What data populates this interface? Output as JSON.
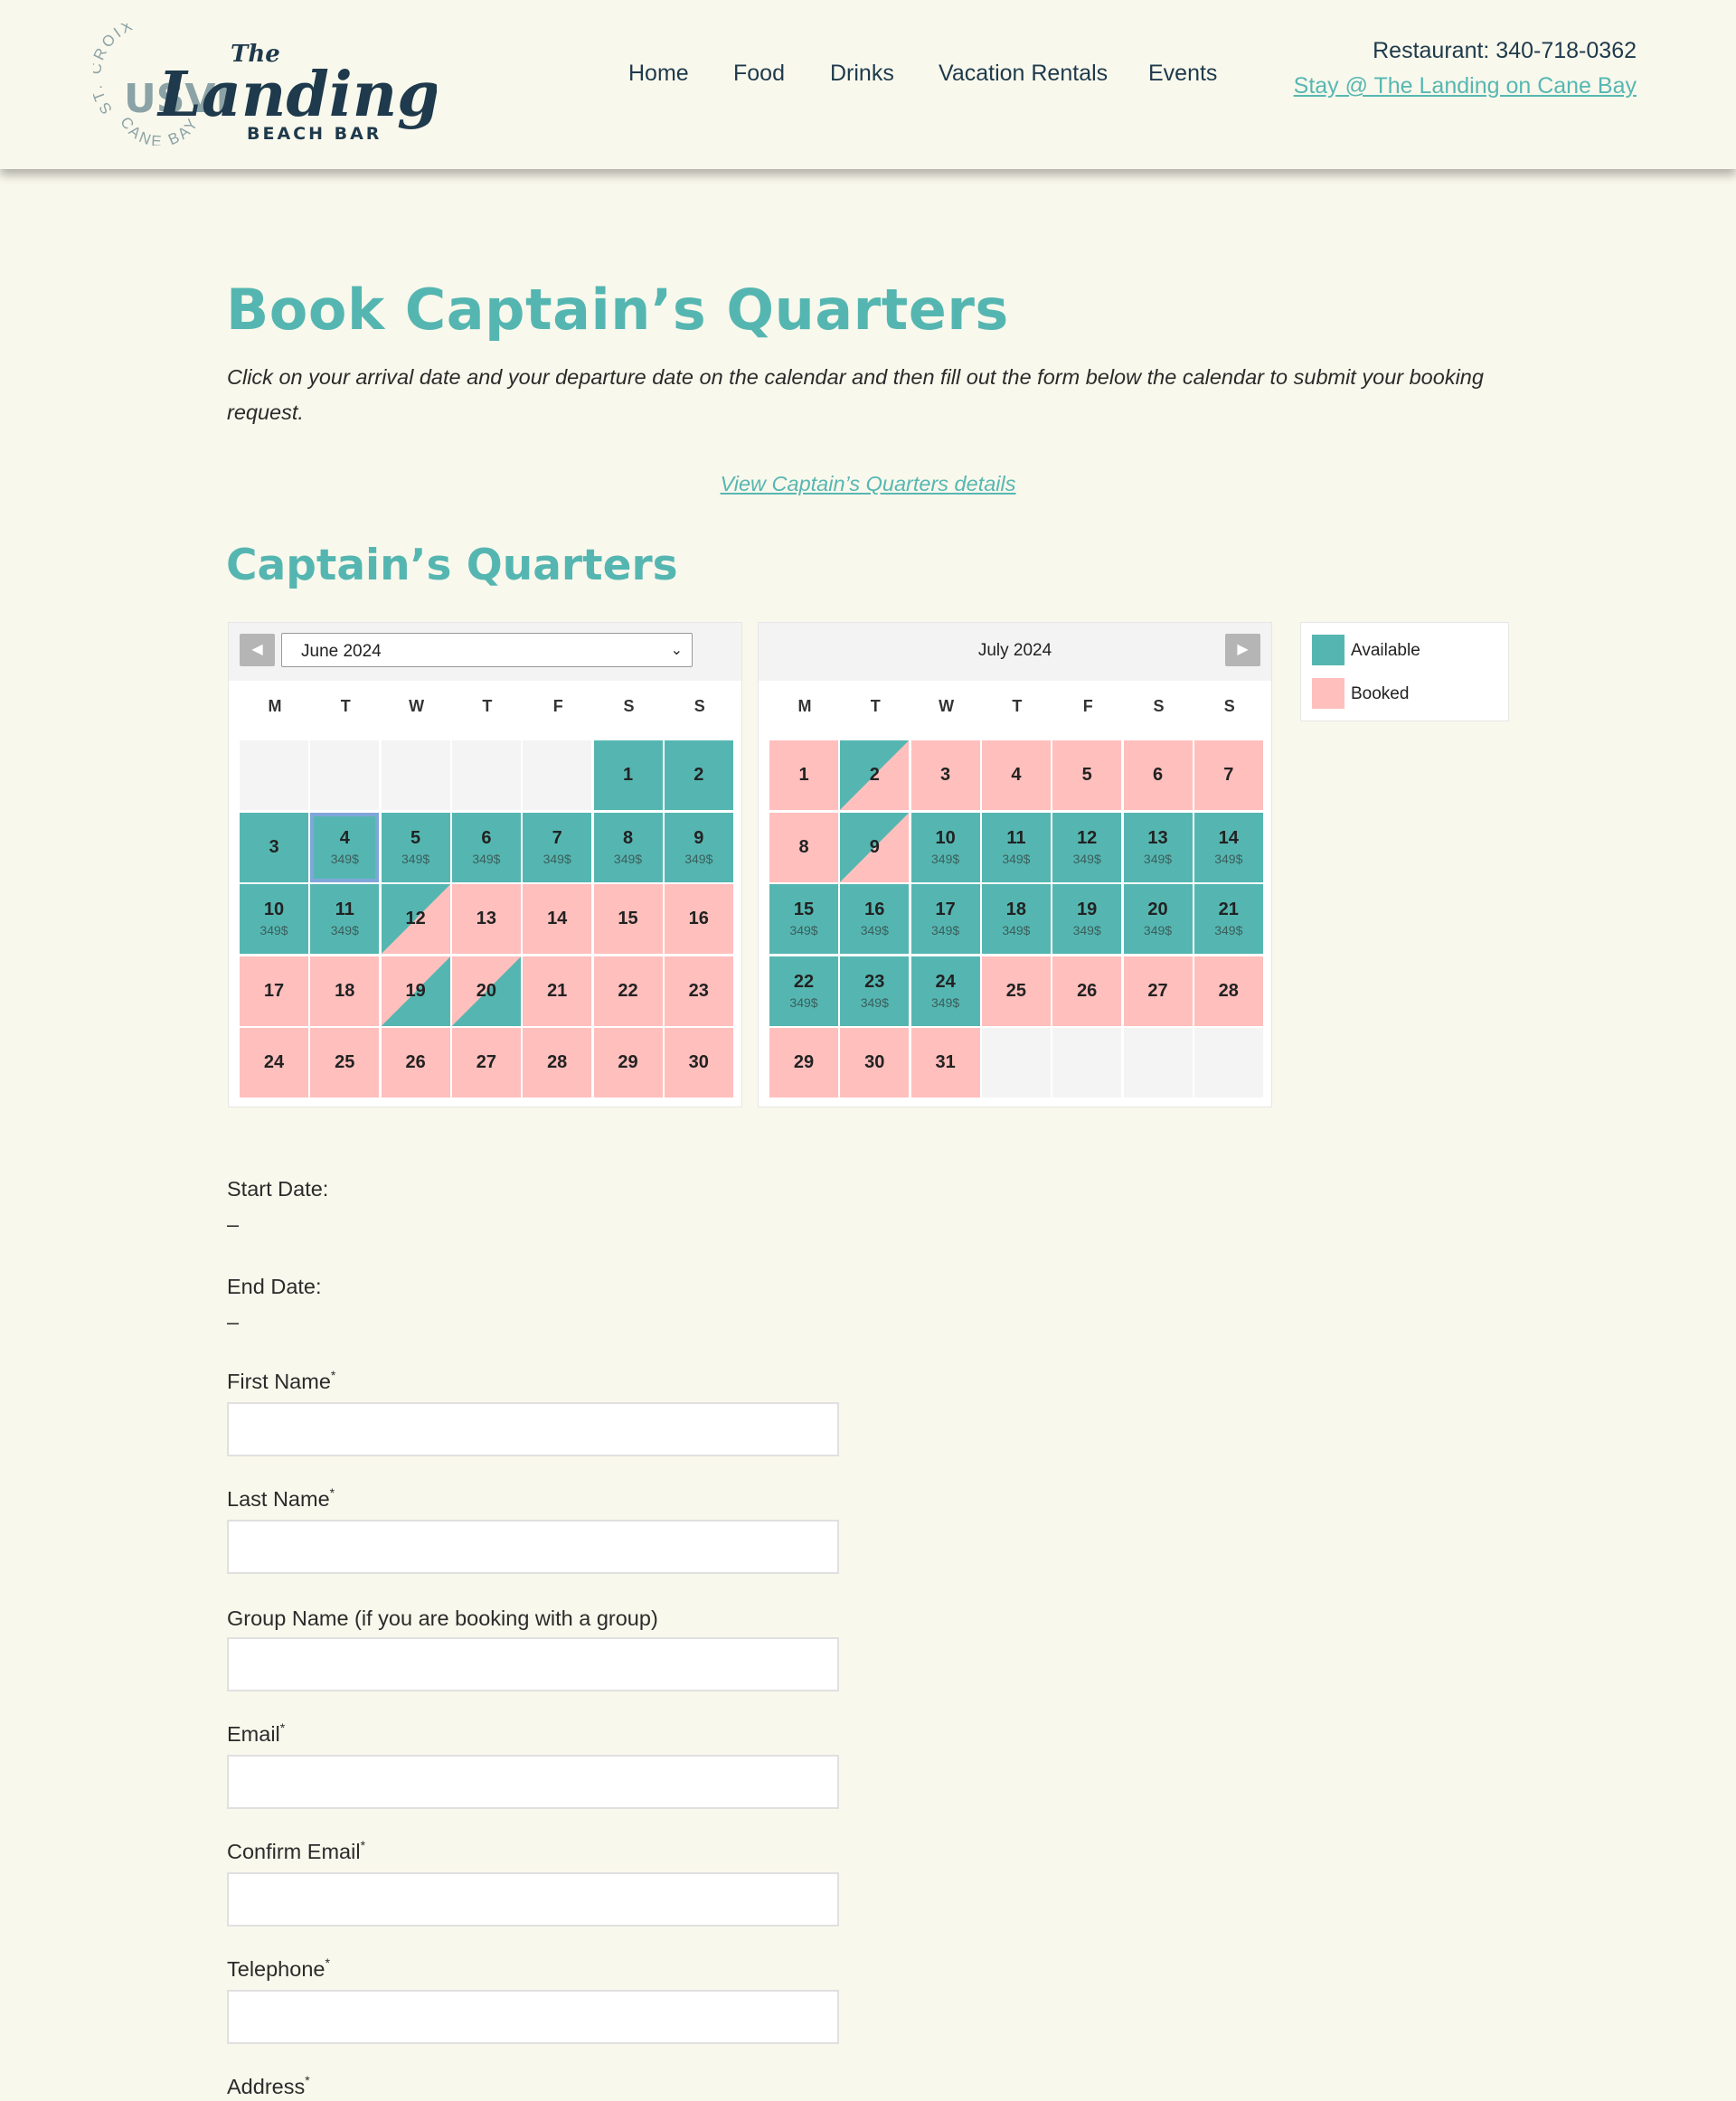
{
  "header": {
    "logo": {
      "arc_top": "ST. CROIX",
      "arc_bottom": "CANE BAY",
      "badge": "USVI",
      "the": "The",
      "name": "Landing",
      "sub": "BEACH BAR"
    },
    "nav": [
      "Home",
      "Food",
      "Drinks",
      "Vacation Rentals",
      "Events"
    ],
    "phone": "Restaurant: 340-718-0362",
    "stay_link": "Stay @ The Landing on Cane Bay"
  },
  "page": {
    "title": "Book Captain’s Quarters",
    "intro": "Click on your arrival date and your departure date on the calendar and then fill out the form below the calendar to submit your booking request.",
    "details_link": "View Captain’s Quarters details",
    "subtitle": "Captain’s Quarters"
  },
  "calendar": {
    "weekdays": [
      "M",
      "T",
      "W",
      "T",
      "F",
      "S",
      "S"
    ],
    "months": [
      {
        "label": "June 2024",
        "is_select": true,
        "days": [
          {
            "t": "em"
          },
          {
            "t": "em"
          },
          {
            "t": "em"
          },
          {
            "t": "em"
          },
          {
            "t": "em"
          },
          {
            "n": "1",
            "t": "av"
          },
          {
            "n": "2",
            "t": "av"
          },
          {
            "n": "3",
            "t": "av"
          },
          {
            "n": "4",
            "t": "av",
            "p": "349$",
            "sel": true
          },
          {
            "n": "5",
            "t": "av",
            "p": "349$"
          },
          {
            "n": "6",
            "t": "av",
            "p": "349$"
          },
          {
            "n": "7",
            "t": "av",
            "p": "349$"
          },
          {
            "n": "8",
            "t": "av",
            "p": "349$"
          },
          {
            "n": "9",
            "t": "av",
            "p": "349$"
          },
          {
            "n": "10",
            "t": "av",
            "p": "349$"
          },
          {
            "n": "11",
            "t": "av",
            "p": "349$"
          },
          {
            "n": "12",
            "t": "pm"
          },
          {
            "n": "13",
            "t": "bk"
          },
          {
            "n": "14",
            "t": "bk"
          },
          {
            "n": "15",
            "t": "bk"
          },
          {
            "n": "16",
            "t": "bk"
          },
          {
            "n": "17",
            "t": "bk"
          },
          {
            "n": "18",
            "t": "bk"
          },
          {
            "n": "19",
            "t": "am"
          },
          {
            "n": "20",
            "t": "am"
          },
          {
            "n": "21",
            "t": "bk"
          },
          {
            "n": "22",
            "t": "bk"
          },
          {
            "n": "23",
            "t": "bk"
          },
          {
            "n": "24",
            "t": "bk"
          },
          {
            "n": "25",
            "t": "bk"
          },
          {
            "n": "26",
            "t": "bk"
          },
          {
            "n": "27",
            "t": "bk"
          },
          {
            "n": "28",
            "t": "bk"
          },
          {
            "n": "29",
            "t": "bk"
          },
          {
            "n": "30",
            "t": "bk"
          }
        ]
      },
      {
        "label": "July 2024",
        "is_select": false,
        "days": [
          {
            "n": "1",
            "t": "bk"
          },
          {
            "n": "2",
            "t": "pm"
          },
          {
            "n": "3",
            "t": "bk"
          },
          {
            "n": "4",
            "t": "bk"
          },
          {
            "n": "5",
            "t": "bk"
          },
          {
            "n": "6",
            "t": "bk"
          },
          {
            "n": "7",
            "t": "bk"
          },
          {
            "n": "8",
            "t": "bk"
          },
          {
            "n": "9",
            "t": "pm"
          },
          {
            "n": "10",
            "t": "av",
            "p": "349$"
          },
          {
            "n": "11",
            "t": "av",
            "p": "349$"
          },
          {
            "n": "12",
            "t": "av",
            "p": "349$"
          },
          {
            "n": "13",
            "t": "av",
            "p": "349$"
          },
          {
            "n": "14",
            "t": "av",
            "p": "349$"
          },
          {
            "n": "15",
            "t": "av",
            "p": "349$"
          },
          {
            "n": "16",
            "t": "av",
            "p": "349$"
          },
          {
            "n": "17",
            "t": "av",
            "p": "349$"
          },
          {
            "n": "18",
            "t": "av",
            "p": "349$"
          },
          {
            "n": "19",
            "t": "av",
            "p": "349$"
          },
          {
            "n": "20",
            "t": "av",
            "p": "349$"
          },
          {
            "n": "21",
            "t": "av",
            "p": "349$"
          },
          {
            "n": "22",
            "t": "av",
            "p": "349$"
          },
          {
            "n": "23",
            "t": "av",
            "p": "349$"
          },
          {
            "n": "24",
            "t": "av",
            "p": "349$"
          },
          {
            "n": "25",
            "t": "bk"
          },
          {
            "n": "26",
            "t": "bk"
          },
          {
            "n": "27",
            "t": "bk"
          },
          {
            "n": "28",
            "t": "bk"
          },
          {
            "n": "29",
            "t": "bk"
          },
          {
            "n": "30",
            "t": "bk"
          },
          {
            "n": "31",
            "t": "bk"
          },
          {
            "t": "em"
          },
          {
            "t": "em"
          },
          {
            "t": "em"
          },
          {
            "t": "em"
          }
        ]
      }
    ],
    "legend": [
      {
        "label": "Available",
        "color": "#55b6b1"
      },
      {
        "label": "Booked",
        "color": "#ffbfbd"
      }
    ],
    "prev_icon": "triangle-left-icon",
    "next_icon": "triangle-right-icon"
  },
  "form": {
    "start_label": "Start Date:",
    "start_value": "–",
    "end_label": "End Date:",
    "end_value": "–",
    "fields": [
      {
        "label": "First Name",
        "required": true
      },
      {
        "label": "Last Name",
        "required": true
      },
      {
        "label": "Group Name (if you are booking with a group)",
        "required": false
      },
      {
        "label": "Email",
        "required": true
      },
      {
        "label": "Confirm Email",
        "required": true
      },
      {
        "label": "Telephone",
        "required": true
      },
      {
        "label": "Address",
        "required": true
      }
    ],
    "required_mark": "*"
  },
  "colors": {
    "accent": "#55b6b1",
    "booked": "#ffbfbd",
    "navy": "#1e3a4c",
    "background": "#f9f8ec"
  }
}
